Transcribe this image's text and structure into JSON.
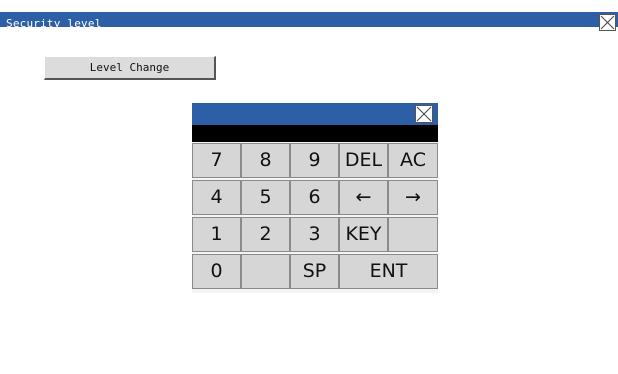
{
  "window": {
    "title": "Security level",
    "close_icon": "close-x-icon",
    "title_bar_color": "#2d5fa6"
  },
  "main": {
    "level_change_label": "Level Change"
  },
  "keypad": {
    "title": "",
    "display_value": "",
    "close_icon": "close-x-icon",
    "keys": [
      "7",
      "8",
      "9",
      "DEL",
      "AC",
      "4",
      "5",
      "6",
      "←",
      "→",
      "1",
      "2",
      "3",
      "KEY",
      "",
      "0",
      "",
      "SP",
      "ENT"
    ]
  }
}
